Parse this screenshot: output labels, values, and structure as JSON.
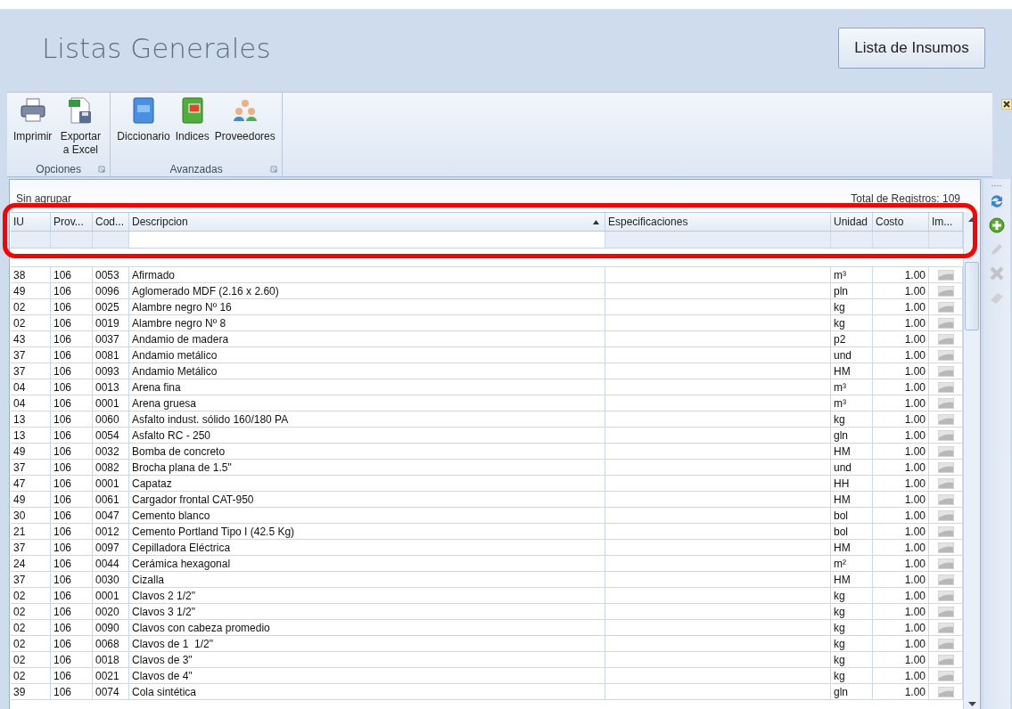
{
  "header": {
    "title": "Listas Generales",
    "button": "Lista de Insumos"
  },
  "ribbon": {
    "groups": [
      {
        "label": "Opciones",
        "items": [
          {
            "kind": "print",
            "label": "Imprimir"
          },
          {
            "kind": "excel",
            "label": "Exportar a Excel"
          }
        ]
      },
      {
        "label": "Avanzadas",
        "items": [
          {
            "kind": "dictionary",
            "label": "Diccionario"
          },
          {
            "kind": "index",
            "label": "Indices"
          },
          {
            "kind": "people",
            "label": "Proveedores"
          }
        ]
      }
    ]
  },
  "grid": {
    "group_label": "Sin agrupar",
    "total": "Total de Registros: 109",
    "columns": [
      {
        "label": "IU",
        "sorted": false,
        "filter_focused": false
      },
      {
        "label": "Prov...",
        "sorted": false,
        "filter_focused": false
      },
      {
        "label": "Cod...",
        "sorted": false,
        "filter_focused": false
      },
      {
        "label": "Descripcion",
        "sorted": true,
        "filter_focused": true
      },
      {
        "label": "Especificaciones",
        "sorted": false,
        "filter_focused": false
      },
      {
        "label": "Unidad",
        "sorted": false,
        "filter_focused": false
      },
      {
        "label": "Costo",
        "sorted": false,
        "filter_focused": false
      },
      {
        "label": "Im...",
        "sorted": false,
        "filter_focused": false
      }
    ],
    "rows": [
      {
        "iu": "38",
        "prov": "106",
        "cod": "0053",
        "desc": "Afirmado",
        "unit": "m³",
        "cost": "1.00"
      },
      {
        "iu": "49",
        "prov": "106",
        "cod": "0096",
        "desc": "Aglomerado MDF (2.16 x 2.60)",
        "unit": "pln",
        "cost": "1.00"
      },
      {
        "iu": "02",
        "prov": "106",
        "cod": "0025",
        "desc": "Alambre negro Nº 16",
        "unit": "kg",
        "cost": "1.00"
      },
      {
        "iu": "02",
        "prov": "106",
        "cod": "0019",
        "desc": "Alambre negro Nº 8",
        "unit": "kg",
        "cost": "1.00"
      },
      {
        "iu": "43",
        "prov": "106",
        "cod": "0037",
        "desc": "Andamio de madera",
        "unit": "p2",
        "cost": "1.00"
      },
      {
        "iu": "37",
        "prov": "106",
        "cod": "0081",
        "desc": "Andamio metálico",
        "unit": "und",
        "cost": "1.00"
      },
      {
        "iu": "37",
        "prov": "106",
        "cod": "0093",
        "desc": "Andamio Metálico",
        "unit": "HM",
        "cost": "1.00"
      },
      {
        "iu": "04",
        "prov": "106",
        "cod": "0013",
        "desc": "Arena fina",
        "unit": "m³",
        "cost": "1.00"
      },
      {
        "iu": "04",
        "prov": "106",
        "cod": "0001",
        "desc": "Arena gruesa",
        "unit": "m³",
        "cost": "1.00"
      },
      {
        "iu": "13",
        "prov": "106",
        "cod": "0060",
        "desc": "Asfalto indust. sólido 160/180 PA",
        "unit": "kg",
        "cost": "1.00"
      },
      {
        "iu": "13",
        "prov": "106",
        "cod": "0054",
        "desc": "Asfalto RC - 250",
        "unit": "gln",
        "cost": "1.00"
      },
      {
        "iu": "49",
        "prov": "106",
        "cod": "0032",
        "desc": "Bomba de concreto",
        "unit": "HM",
        "cost": "1.00"
      },
      {
        "iu": "37",
        "prov": "106",
        "cod": "0082",
        "desc": "Brocha plana de 1.5\"",
        "unit": "und",
        "cost": "1.00"
      },
      {
        "iu": "47",
        "prov": "106",
        "cod": "0001",
        "desc": "Capataz",
        "unit": "HH",
        "cost": "1.00"
      },
      {
        "iu": "49",
        "prov": "106",
        "cod": "0061",
        "desc": "Cargador frontal CAT-950",
        "unit": "HM",
        "cost": "1.00"
      },
      {
        "iu": "30",
        "prov": "106",
        "cod": "0047",
        "desc": "Cemento blanco",
        "unit": "bol",
        "cost": "1.00"
      },
      {
        "iu": "21",
        "prov": "106",
        "cod": "0012",
        "desc": "Cemento Portland Tipo I (42.5 Kg)",
        "unit": "bol",
        "cost": "1.00"
      },
      {
        "iu": "37",
        "prov": "106",
        "cod": "0097",
        "desc": "Cepilladora Eléctrica",
        "unit": "HM",
        "cost": "1.00"
      },
      {
        "iu": "24",
        "prov": "106",
        "cod": "0044",
        "desc": "Cerámica hexagonal",
        "unit": "m²",
        "cost": "1.00"
      },
      {
        "iu": "37",
        "prov": "106",
        "cod": "0030",
        "desc": "Cizalla",
        "unit": "HM",
        "cost": "1.00"
      },
      {
        "iu": "02",
        "prov": "106",
        "cod": "0001",
        "desc": "Clavos 2 1/2\"",
        "unit": "kg",
        "cost": "1.00"
      },
      {
        "iu": "02",
        "prov": "106",
        "cod": "0020",
        "desc": "Clavos 3 1/2\"",
        "unit": "kg",
        "cost": "1.00"
      },
      {
        "iu": "02",
        "prov": "106",
        "cod": "0090",
        "desc": "Clavos con cabeza promedio",
        "unit": "kg",
        "cost": "1.00"
      },
      {
        "iu": "02",
        "prov": "106",
        "cod": "0068",
        "desc": "Clavos de 1  1/2\"",
        "unit": "kg",
        "cost": "1.00"
      },
      {
        "iu": "02",
        "prov": "106",
        "cod": "0018",
        "desc": "Clavos de 3\"",
        "unit": "kg",
        "cost": "1.00"
      },
      {
        "iu": "02",
        "prov": "106",
        "cod": "0021",
        "desc": "Clavos de 4\"",
        "unit": "kg",
        "cost": "1.00"
      },
      {
        "iu": "39",
        "prov": "106",
        "cod": "0074",
        "desc": "Cola sintética",
        "unit": "gln",
        "cost": "1.00"
      }
    ]
  },
  "side_tools": [
    {
      "kind": "refresh",
      "disabled": false
    },
    {
      "kind": "add",
      "disabled": false
    },
    {
      "kind": "edit",
      "disabled": true
    },
    {
      "kind": "delete",
      "disabled": true
    },
    {
      "kind": "erase",
      "disabled": true
    }
  ]
}
